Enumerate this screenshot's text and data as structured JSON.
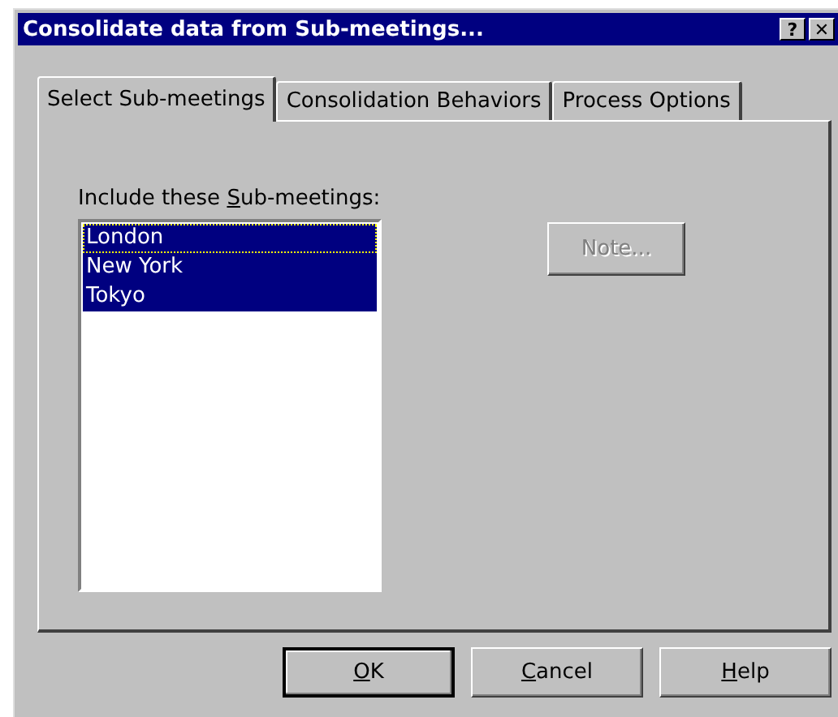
{
  "window": {
    "title": "Consolidate data from Sub-meetings...",
    "title_buttons": [
      "?",
      "✕"
    ]
  },
  "tabs": [
    {
      "label": "Select Sub-meetings",
      "selected": true
    },
    {
      "label": "Consolidation Behaviors",
      "selected": false
    },
    {
      "label": "Process Options",
      "selected": false
    }
  ],
  "list_label": {
    "before": "Include these ",
    "key": "S",
    "after": "ub-meetings:"
  },
  "list": [
    {
      "label": "London",
      "selected": true,
      "focused": true
    },
    {
      "label": "New York",
      "selected": true,
      "focused": false
    },
    {
      "label": "Tokyo",
      "selected": true,
      "focused": false
    }
  ],
  "note_button": {
    "label": "Note...",
    "disabled": true
  },
  "buttons": [
    {
      "key": "O",
      "after": "K",
      "default": true
    },
    {
      "key": "C",
      "after": "ancel",
      "default": false
    },
    {
      "key": "H",
      "after": "elp",
      "default": false
    }
  ]
}
